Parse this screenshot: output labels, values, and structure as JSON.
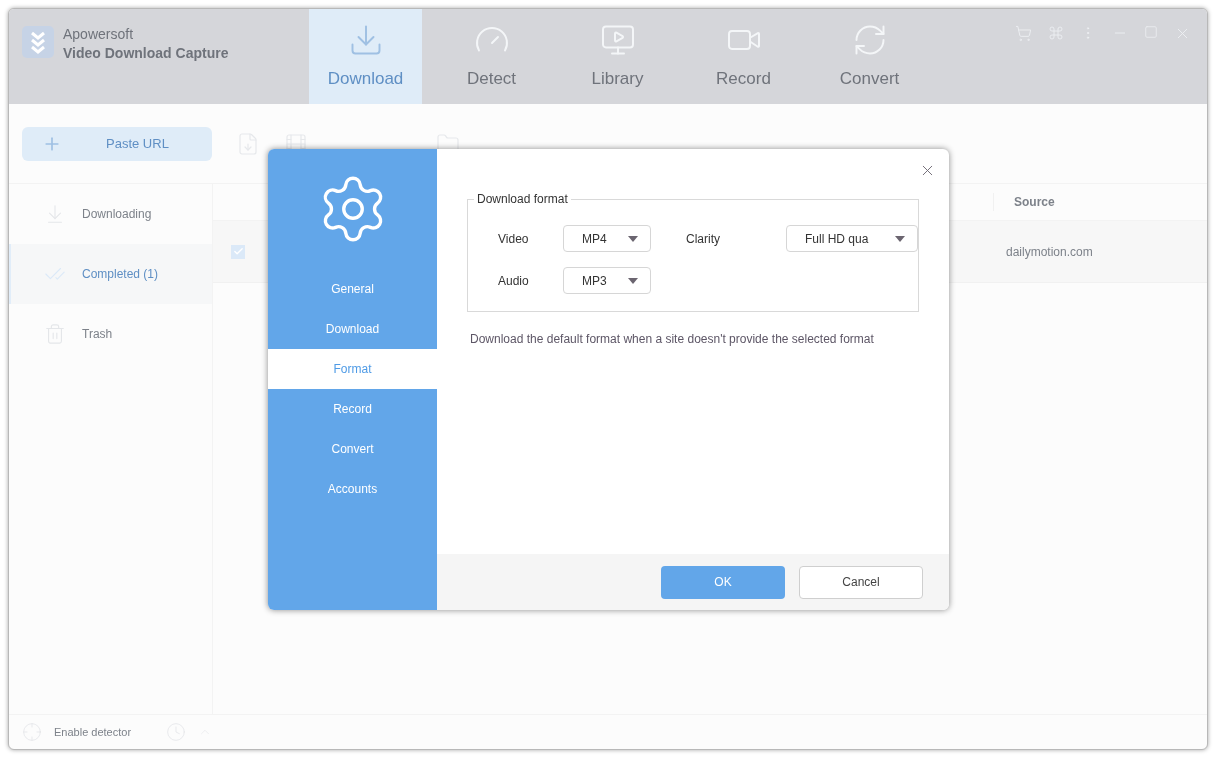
{
  "app": {
    "brand": "Apowersoft",
    "product": "Video Download Capture"
  },
  "nav_tabs": [
    {
      "label": "Download",
      "selected": true
    },
    {
      "label": "Detect",
      "selected": false
    },
    {
      "label": "Library",
      "selected": false
    },
    {
      "label": "Record",
      "selected": false
    },
    {
      "label": "Convert",
      "selected": false
    }
  ],
  "paste_url": "Paste URL",
  "sidebar": {
    "items": [
      {
        "label": "Downloading",
        "selected": false
      },
      {
        "label": "Completed (1)",
        "selected": true
      },
      {
        "label": "Trash",
        "selected": false
      }
    ]
  },
  "table": {
    "columns": [
      "Source"
    ],
    "rows": [
      {
        "checked": true,
        "source": "dailymotion.com"
      }
    ]
  },
  "status_bar": {
    "detector": "Enable detector"
  },
  "dialog": {
    "nav": [
      {
        "label": "General",
        "selected": false
      },
      {
        "label": "Download",
        "selected": false
      },
      {
        "label": "Format",
        "selected": true
      },
      {
        "label": "Record",
        "selected": false
      },
      {
        "label": "Convert",
        "selected": false
      },
      {
        "label": "Accounts",
        "selected": false
      }
    ],
    "group_title": "Download format",
    "fields": [
      {
        "label": "Video",
        "value": "MP4"
      },
      {
        "label": "Clarity",
        "value": "Full HD qua"
      },
      {
        "label": "Audio",
        "value": "MP3"
      }
    ],
    "note": "Download the default format when a site doesn't provide the selected format",
    "buttons": [
      {
        "label": "OK",
        "kind": "primary"
      },
      {
        "label": "Cancel",
        "kind": "secondary"
      }
    ]
  }
}
